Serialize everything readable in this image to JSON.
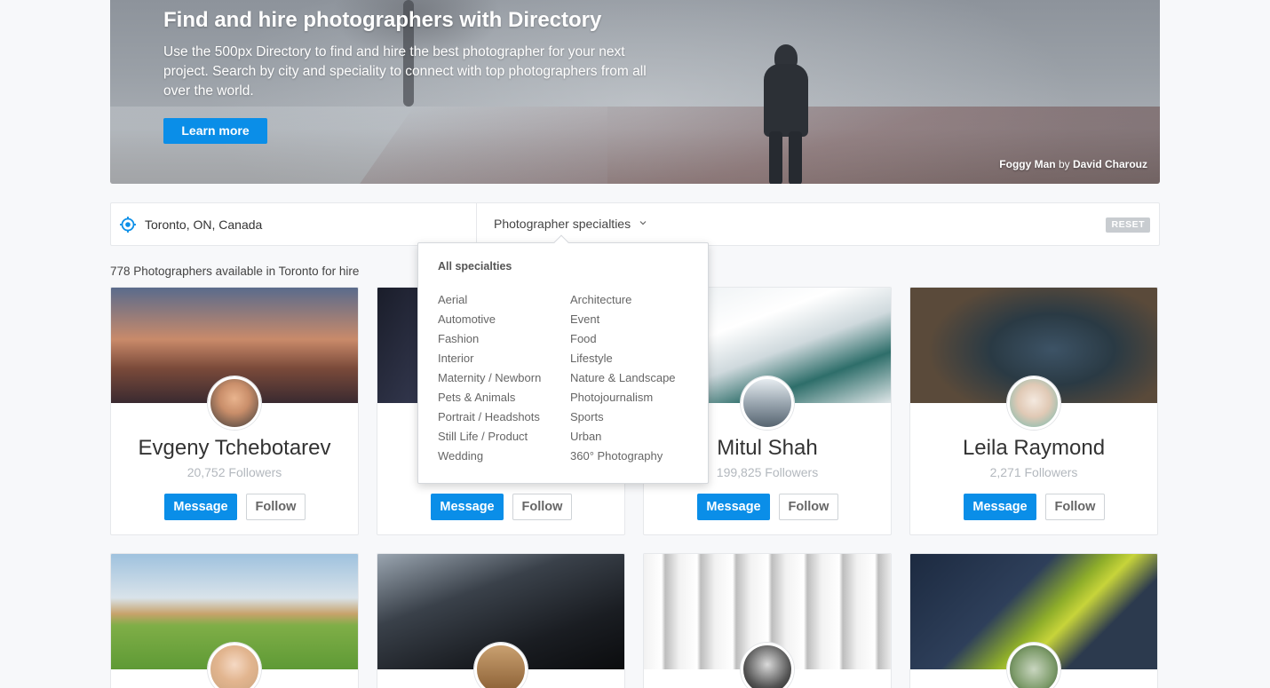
{
  "hero": {
    "title": "Find and hire photographers with Directory",
    "description": "Use the 500px Directory to find and hire the best photographer for your next project. Search by city and speciality to connect with top photographers from all over the world.",
    "button_label": "Learn more",
    "credit_title": "Foggy Man",
    "credit_by": "by",
    "credit_author": "David Charouz"
  },
  "filter": {
    "location_value": "Toronto, ON, Canada",
    "specialties_label": "Photographer specialties",
    "reset_label": "RESET"
  },
  "result_count": "778 Photographers available in Toronto for hire",
  "dropdown": {
    "all_label": "All specialties",
    "col1": [
      "Aerial",
      "Automotive",
      "Fashion",
      "Interior",
      "Maternity / Newborn",
      "Pets & Animals",
      "Portrait / Headshots",
      "Still Life / Product",
      "Wedding"
    ],
    "col2": [
      "Architecture",
      "Event",
      "Food",
      "Lifestyle",
      "Nature & Landscape",
      "Photojournalism",
      "Sports",
      "Urban",
      "360° Photography"
    ]
  },
  "cards": [
    {
      "name": "Evgeny Tchebotarev",
      "followers": "20,752 Followers",
      "message_label": "Message",
      "follow_label": "Follow"
    },
    {
      "name": "",
      "followers": "",
      "message_label": "Message",
      "follow_label": "Follow"
    },
    {
      "name": "Mitul Shah",
      "followers": "199,825 Followers",
      "message_label": "Message",
      "follow_label": "Follow"
    },
    {
      "name": "Leila Raymond",
      "followers": "2,271 Followers",
      "message_label": "Message",
      "follow_label": "Follow"
    }
  ],
  "colors": {
    "accent": "#0a8ee8",
    "reset_bg": "#c8ccd0",
    "background": "#f7f8fa"
  },
  "icons": {
    "location": "location-target-icon",
    "chevron": "chevron-down-icon"
  }
}
